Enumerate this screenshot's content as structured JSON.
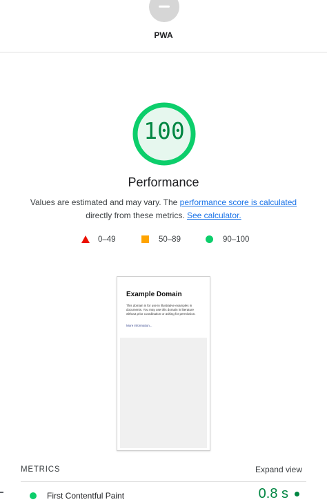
{
  "colors": {
    "pass": "#0cce6b",
    "pass_text": "#018642",
    "pass_fill": "#e6f7ee",
    "average": "#ffa400",
    "fail": "#eb0f00",
    "link": "#1a73e8",
    "pwa_gray": "#d6d6d6"
  },
  "pwa": {
    "label": "PWA",
    "icon": "dash-icon"
  },
  "performance": {
    "score": "100",
    "score_fraction": 1.0,
    "title": "Performance",
    "desc_prefix": "Values are estimated and may vary. The ",
    "desc_link": "performance score is calculated",
    "desc_middle": " directly from these metrics. ",
    "desc_calc_link": "See calculator."
  },
  "legend": [
    {
      "shape": "triangle-icon",
      "range": "0–49"
    },
    {
      "shape": "square-icon",
      "range": "50–89"
    },
    {
      "shape": "circle-icon",
      "range": "90–100"
    }
  ],
  "screenshot": {
    "title": "Example Domain",
    "body": "This domain is for use in illustrative examples in documents. You may use this domain in literature without prior coordination or asking for permission.",
    "link": "More information..."
  },
  "metrics": {
    "header": "METRICS",
    "expand": "Expand view",
    "first_row": {
      "name": "First Contentful Paint",
      "value": "0.8 s"
    }
  }
}
